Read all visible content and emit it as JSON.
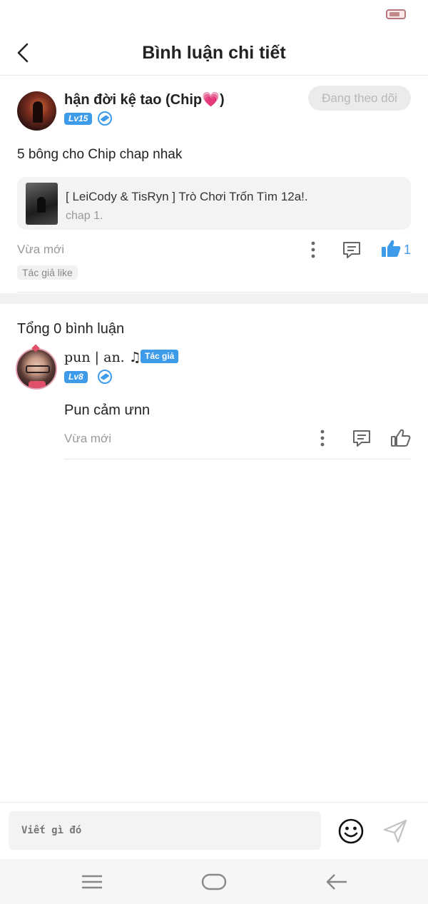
{
  "header": {
    "title": "Bình luận chi tiết"
  },
  "post": {
    "author": "hận đời kệ tao (Chip",
    "author_heart": "💗",
    "author_suffix": ")",
    "level": "Lv15",
    "follow_label": "Đang theo dõi",
    "text": "5 bông cho Chip chap nhak⁣",
    "story": {
      "title": "[ LeiCody & TisRyn ] Trò Chơi Trốn Tìm 12a!.",
      "chapter": "chap 1."
    },
    "time": "Vừa mới",
    "like_count": "1",
    "author_like_tag": "Tác giả like"
  },
  "comments": {
    "total_label": "Tổng 0 bình luận",
    "items": [
      {
        "user": "pun | an. ♫",
        "author_tag": "Tác giả",
        "level": "Lv8",
        "text": "Pun cảm ưnn",
        "time": "Vừa mới"
      }
    ]
  },
  "composer": {
    "placeholder": "Viết gì đó"
  },
  "icons": {
    "back": "chevron-left-icon",
    "more": "more-vertical-icon",
    "reply": "message-square-icon",
    "like": "thumbs-up-icon",
    "emoji": "smile-icon",
    "send": "send-icon",
    "nav_menu": "menu-icon",
    "nav_home": "home-pill-icon",
    "nav_back": "arrow-left-icon",
    "level_gem": "gem-icon",
    "battery": "battery-icon"
  },
  "colors": {
    "accent": "#3d9be9",
    "text_primary": "#222222",
    "text_muted": "#999999",
    "pill_bg": "#ebebeb"
  }
}
